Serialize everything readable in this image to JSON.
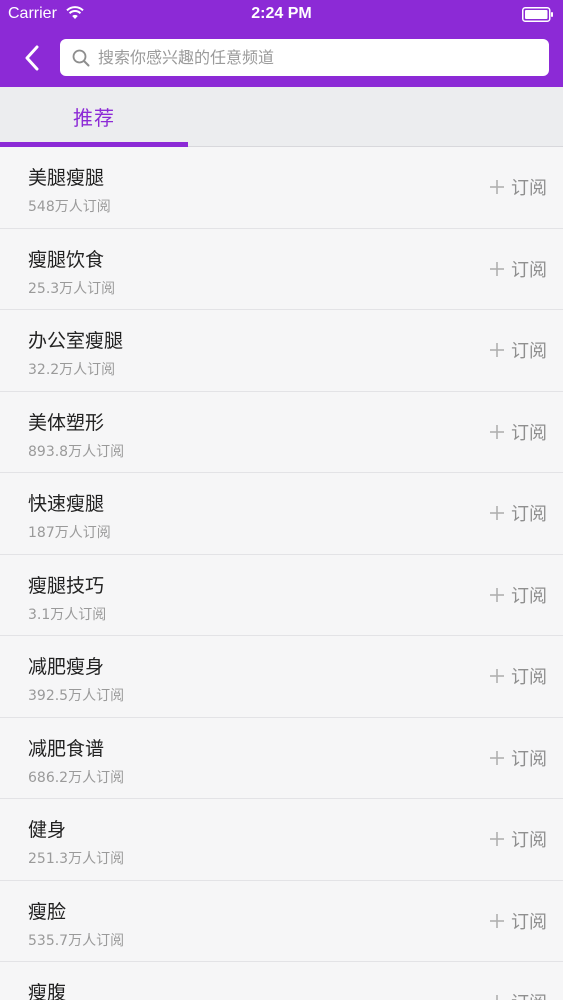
{
  "status_bar": {
    "carrier": "Carrier",
    "time": "2:24 PM"
  },
  "search": {
    "placeholder": "搜索你感兴趣的任意频道"
  },
  "tabs": [
    {
      "label": "推荐"
    }
  ],
  "subscribe_label": "订阅",
  "colors": {
    "accent": "#8c2ad6",
    "background": "#f6f6f7"
  },
  "channels": [
    {
      "title": "美腿瘦腿",
      "subscribers": "548万人订阅"
    },
    {
      "title": "瘦腿饮食",
      "subscribers": "25.3万人订阅"
    },
    {
      "title": "办公室瘦腿",
      "subscribers": "32.2万人订阅"
    },
    {
      "title": "美体塑形",
      "subscribers": "893.8万人订阅"
    },
    {
      "title": "快速瘦腿",
      "subscribers": "187万人订阅"
    },
    {
      "title": "瘦腿技巧",
      "subscribers": "3.1万人订阅"
    },
    {
      "title": "减肥瘦身",
      "subscribers": "392.5万人订阅"
    },
    {
      "title": "减肥食谱",
      "subscribers": "686.2万人订阅"
    },
    {
      "title": "健身",
      "subscribers": "251.3万人订阅"
    },
    {
      "title": "瘦脸",
      "subscribers": "535.7万人订阅"
    },
    {
      "title": "瘦腹",
      "subscribers": ""
    }
  ]
}
